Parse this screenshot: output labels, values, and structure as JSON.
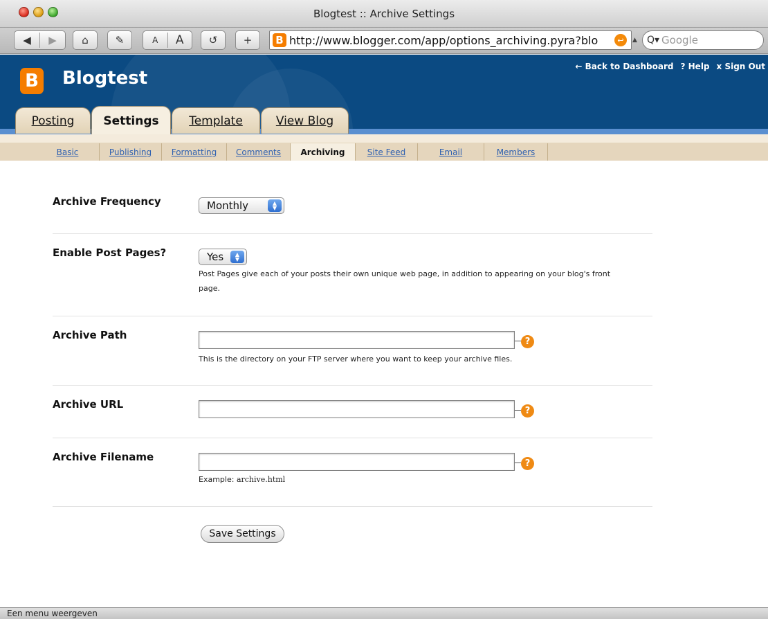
{
  "window": {
    "title": "Blogtest :: Archive Settings"
  },
  "toolbar": {
    "back_glyph": "◀",
    "forward_glyph": "▶",
    "home_glyph": "⌂",
    "edit_glyph": "✎",
    "text_smaller": "A",
    "text_larger": "A",
    "reload_glyph": "↺",
    "add_glyph": "+",
    "url": "http://www.blogger.com/app/options_archiving.pyra?blo",
    "search_placeholder": "Google",
    "search_glyph": "Q▾",
    "favicon_glyph": "B",
    "snap_glyph": "↩",
    "caret_glyph": "▲"
  },
  "header": {
    "logo_glyph": "B",
    "blog_name": "Blogtest",
    "top_links": {
      "dashboard": "← Back to Dashboard",
      "help": "? Help",
      "sign_out": "x Sign Out"
    },
    "tabs": [
      "Posting",
      "Settings",
      "Template",
      "View Blog"
    ],
    "active_tab": "Settings"
  },
  "subnav": {
    "items": [
      "Basic",
      "Publishing",
      "Formatting",
      "Comments",
      "Archiving",
      "Site Feed",
      "Email",
      "Members"
    ],
    "active": "Archiving"
  },
  "form": {
    "frequency": {
      "label": "Archive Frequency",
      "value": "Monthly"
    },
    "post_pages": {
      "label": "Enable Post Pages?",
      "value": "Yes",
      "help_line1": "Post Pages give each of your posts their own unique web page, in addition to appearing on your blog's front",
      "help_line2": "page."
    },
    "path": {
      "label": "Archive Path",
      "value": "",
      "help": "This is the directory on your FTP server where you want to keep your archive files."
    },
    "url": {
      "label": "Archive URL",
      "value": ""
    },
    "filename": {
      "label": "Archive Filename",
      "value": "",
      "example_prefix": "Example:",
      "example_value": "archive.html"
    },
    "help_glyph": "?",
    "stepper_up": "▲",
    "stepper_down": "▼",
    "save_label": "Save Settings"
  },
  "statusbar": {
    "text": "Een menu weergeven"
  },
  "colors": {
    "header_blue": "#0b4a82",
    "accent_orange": "#f57d00",
    "link_blue": "#2e60b0"
  }
}
